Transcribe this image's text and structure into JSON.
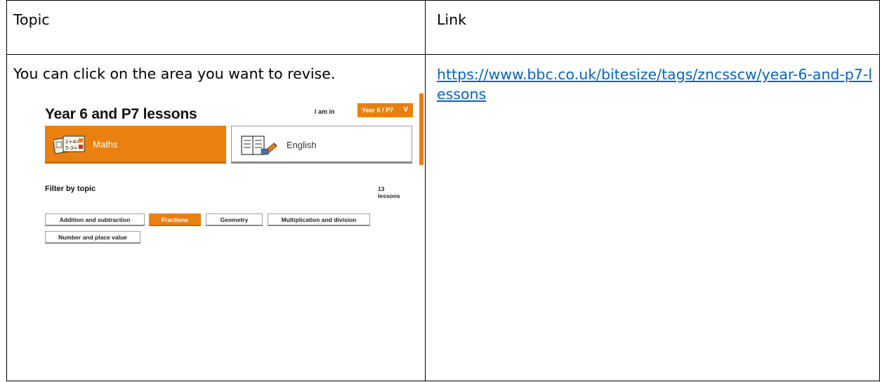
{
  "table": {
    "header": {
      "topic": "Topic",
      "link": "Link"
    },
    "row": {
      "topic_text": "You can click on the area you want to revise.",
      "link_text": "https://www.bbc.co.uk/bitesize/tags/zncsscw/year-6-and-p7-lessons"
    }
  },
  "embedded_page": {
    "title": "Year 6 and P7 lessons",
    "i_am_in_label": "I am in",
    "year_select_value": "Year 6 / P7",
    "subjects": [
      {
        "label": "Maths",
        "active": true
      },
      {
        "label": "English",
        "active": false
      }
    ],
    "filter_label": "Filter by topic",
    "lesson_count": "13 lessons",
    "topics": [
      {
        "label": "Addition and subtraction",
        "active": false
      },
      {
        "label": "Fractions",
        "active": true
      },
      {
        "label": "Geometry",
        "active": false
      },
      {
        "label": "Multiplication and division",
        "active": false
      },
      {
        "label": "Number and place value",
        "active": false
      }
    ],
    "accent_color": "#ea8010",
    "link_color": "#0563c1"
  }
}
